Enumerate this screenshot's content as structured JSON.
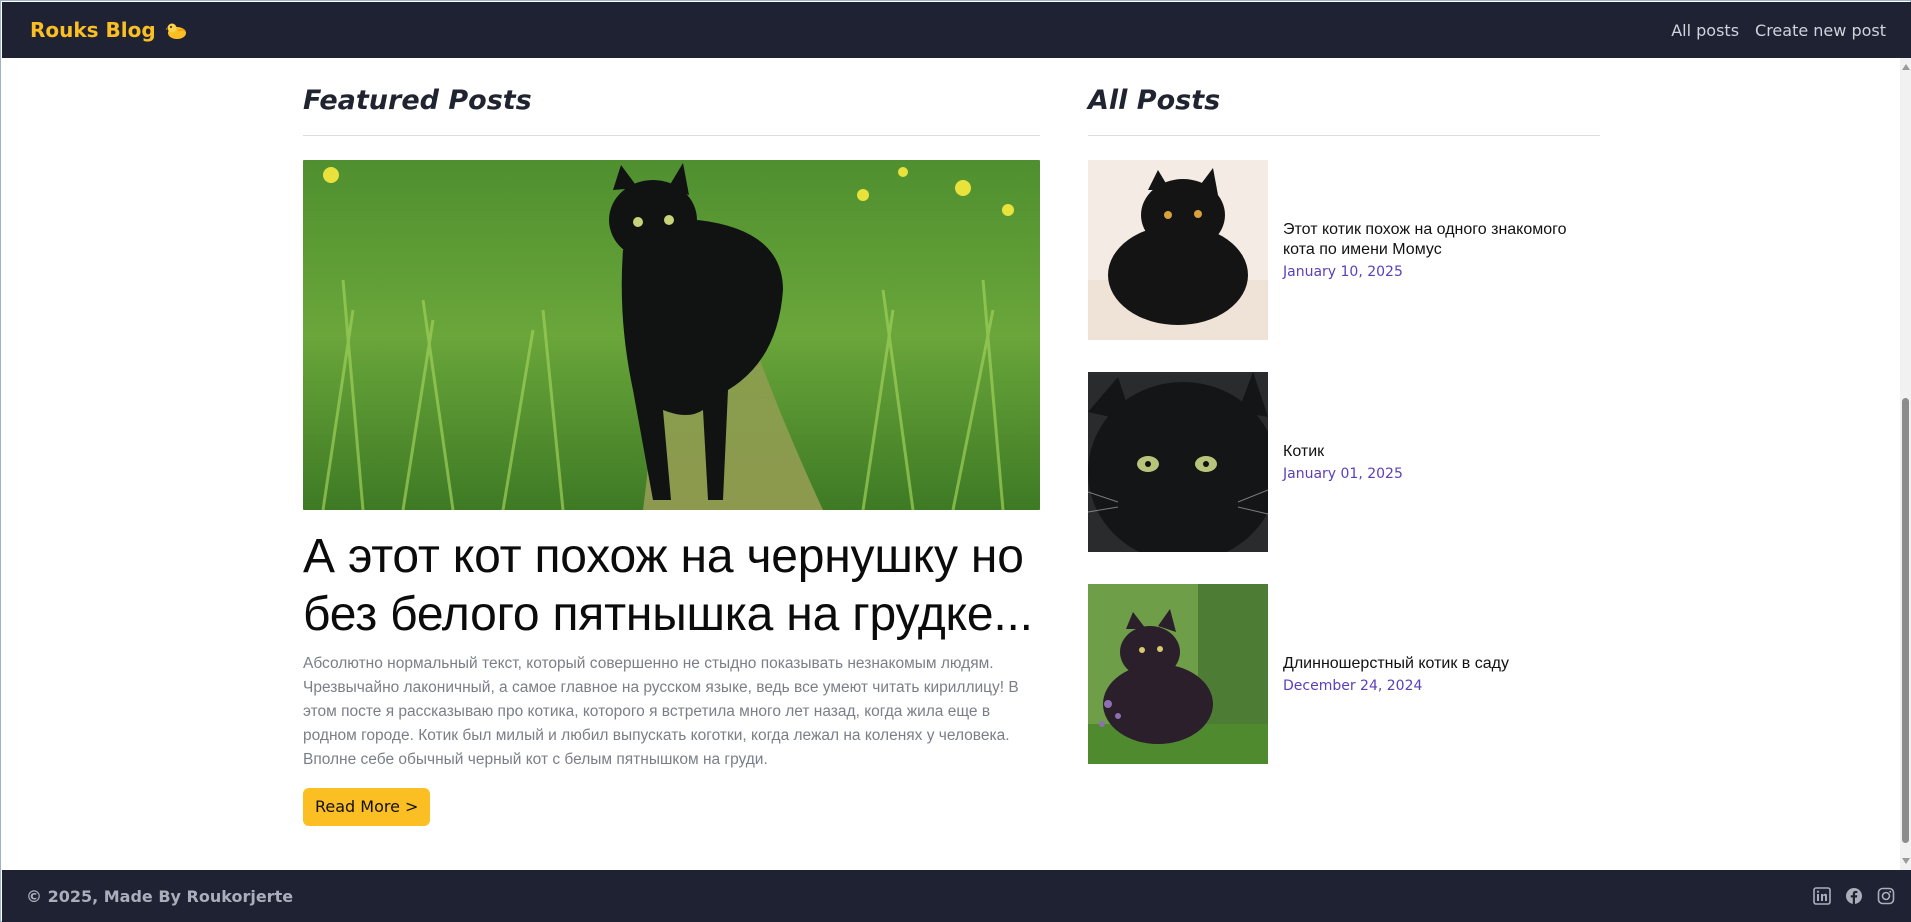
{
  "header": {
    "brand": "Rouks Blog",
    "brand_icon": "chick-icon",
    "nav": [
      {
        "label": "All posts"
      },
      {
        "label": "Create new post"
      }
    ]
  },
  "featured": {
    "section_title": "Featured Posts",
    "post": {
      "title": "А этот кот похож на чернушку но без белого пятнышка на грудке...",
      "excerpt": "Абсолютно нормальный текст, который совершенно не стыдно показывать незнакомым людям. Чрезвычайно лаконичный, а самое главное на русском языке, ведь все умеют читать кириллицу! В этом посте я рассказываю про котика, которого я встретила много лет назад, когда жила еще в родном городе. Котик был милый и любил выпускать коготки, когда лежал на коленях у человека. Вполне себе обычный черный кот с белым пятнышком на груди.",
      "read_more": "Read More >"
    }
  },
  "all_posts": {
    "section_title": "All Posts",
    "items": [
      {
        "title": "Этот котик похож на одного знакомого кота по имени Момус",
        "date": "January 10, 2025"
      },
      {
        "title": "Котик",
        "date": "January 01, 2025"
      },
      {
        "title": "Длинношерстный котик в саду",
        "date": "December 24, 2024"
      }
    ]
  },
  "footer": {
    "copyright": "© 2025, Made By Roukorjerte",
    "social": [
      "linkedin-icon",
      "facebook-icon",
      "instagram-icon"
    ]
  },
  "colors": {
    "header_bg": "#1f2233",
    "brand": "#fbbf24",
    "button": "#fbbf24",
    "date": "#5b3fb8"
  }
}
